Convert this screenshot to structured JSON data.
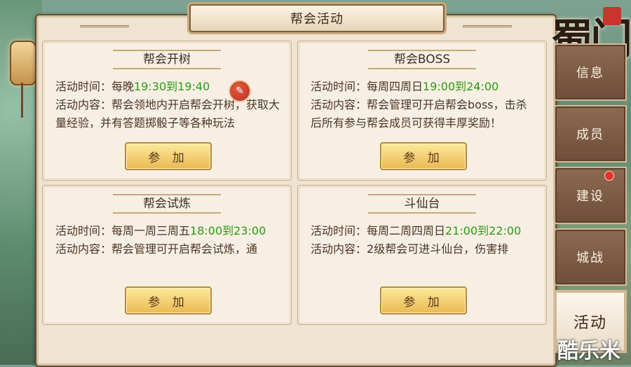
{
  "window": {
    "title": "帮会活动"
  },
  "activities": [
    {
      "title": "帮会开树",
      "time_label": "活动时间：",
      "time_prefix": "每晚",
      "time_value": "19:30到19:40",
      "content_label": "活动内容：",
      "content": "帮会领地内开启帮会开树，获取大量经验，并有答题掷骰子等各种玩法",
      "join_label": "参  加"
    },
    {
      "title": "帮会BOSS",
      "time_label": "活动时间：",
      "time_prefix": "每周四周日",
      "time_value": "19:00到24:00",
      "content_label": "活动内容：",
      "content": "帮会管理可开启帮会boss，击杀后所有参与帮会成员可获得丰厚奖励！",
      "join_label": "参  加"
    },
    {
      "title": "帮会试炼",
      "time_label": "活动时间：",
      "time_prefix": "每周一周三周五",
      "time_value": "18:00到23:00",
      "content_label": "活动内容：",
      "content": "帮会管理可开启帮会试炼，通",
      "join_label": "参  加"
    },
    {
      "title": "斗仙台",
      "time_label": "活动时间：",
      "time_prefix": "每周二周四周日",
      "time_value": "21:00到22:00",
      "content_label": "活动内容：",
      "content": "2级帮会可进斗仙台，伤害排",
      "join_label": "参  加"
    }
  ],
  "edit_icon": "brush-icon",
  "logo": {
    "text": "蜀门"
  },
  "tabs": [
    {
      "label": "信息",
      "active": false,
      "badge": false
    },
    {
      "label": "成员",
      "active": false,
      "badge": false
    },
    {
      "label": "建设",
      "active": false,
      "badge": true
    },
    {
      "label": "城战",
      "active": false,
      "badge": false
    },
    {
      "label": "活动",
      "active": true,
      "badge": false
    }
  ],
  "watermark": "酷乐米",
  "colors": {
    "time_highlight": "#2b9a13",
    "badge_red": "#e1332a"
  }
}
